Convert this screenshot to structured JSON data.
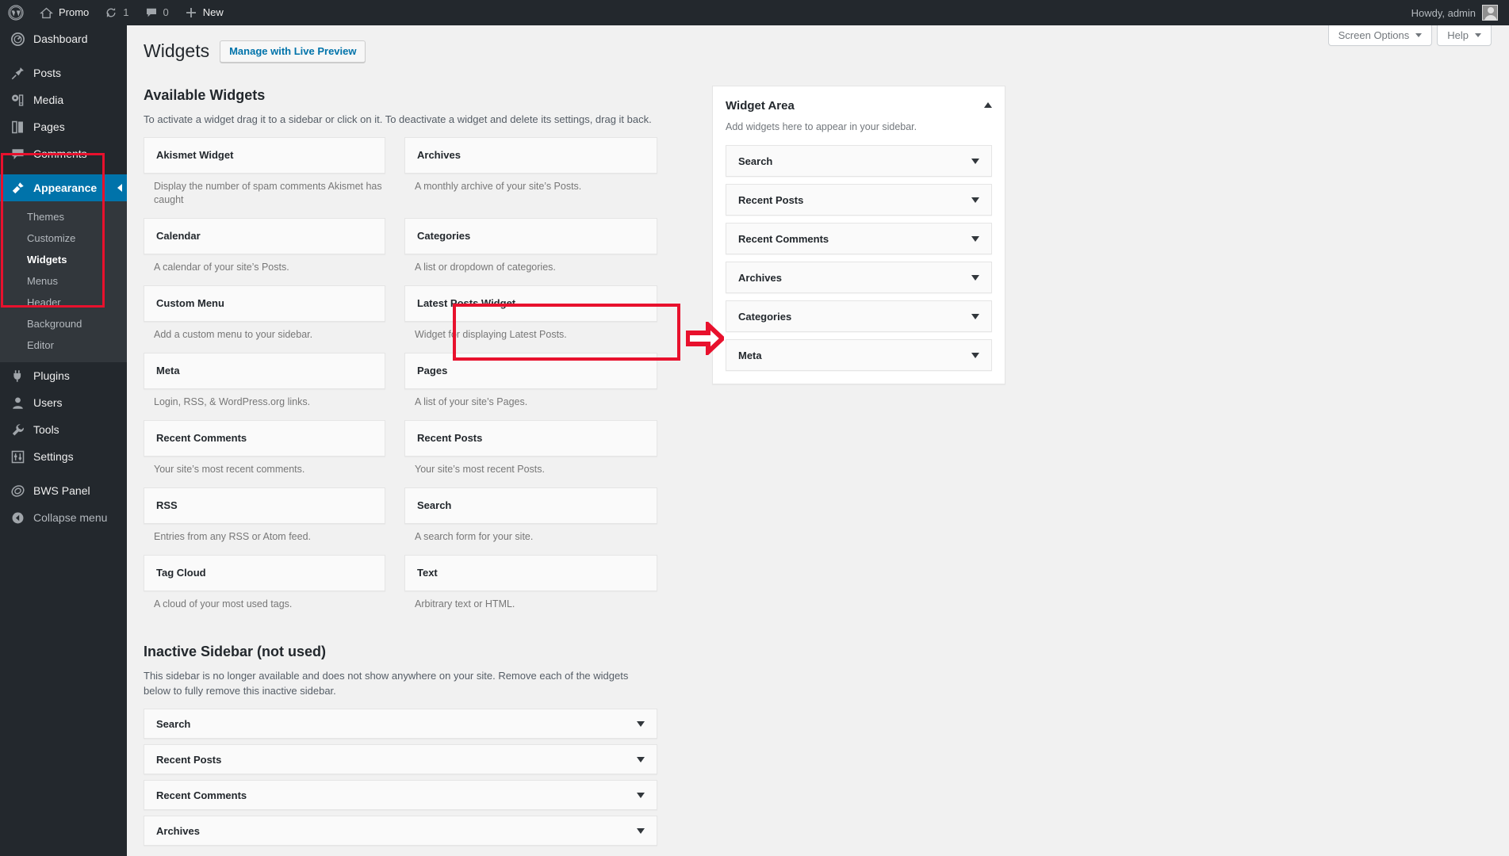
{
  "adminbar": {
    "wp_logo_label": "wordpress-logo",
    "site_name": "Promo",
    "updates_count": "1",
    "comments_count": "0",
    "new_label": "New",
    "howdy": "Howdy, admin"
  },
  "sidebar": {
    "items": [
      {
        "label": "Dashboard",
        "icon": "dashboard-icon"
      },
      {
        "label": "Posts",
        "icon": "posts-pin-icon"
      },
      {
        "label": "Media",
        "icon": "media-icon"
      },
      {
        "label": "Pages",
        "icon": "pages-icon"
      },
      {
        "label": "Comments",
        "icon": "comments-icon"
      },
      {
        "label": "Appearance",
        "icon": "appearance-brush-icon"
      },
      {
        "label": "Plugins",
        "icon": "plugins-plug-icon"
      },
      {
        "label": "Users",
        "icon": "users-icon"
      },
      {
        "label": "Tools",
        "icon": "tools-wrench-icon"
      },
      {
        "label": "Settings",
        "icon": "settings-sliders-icon"
      },
      {
        "label": "BWS Panel",
        "icon": "bws-panel-icon"
      },
      {
        "label": "Collapse menu",
        "icon": "collapse-arrow-icon"
      }
    ],
    "appearance_submenu": [
      {
        "label": "Themes"
      },
      {
        "label": "Customize"
      },
      {
        "label": "Widgets"
      },
      {
        "label": "Menus"
      },
      {
        "label": "Header"
      },
      {
        "label": "Background"
      },
      {
        "label": "Editor"
      }
    ]
  },
  "screen_meta": {
    "screen_options": "Screen Options",
    "help": "Help"
  },
  "header": {
    "page_title": "Widgets",
    "live_preview_button": "Manage with Live Preview"
  },
  "available": {
    "heading": "Available Widgets",
    "description": "To activate a widget drag it to a sidebar or click on it. To deactivate a widget and delete its settings, drag it back.",
    "widgets": [
      {
        "name": "Akismet Widget",
        "desc": "Display the number of spam comments Akismet has caught"
      },
      {
        "name": "Archives",
        "desc": "A monthly archive of your site’s Posts."
      },
      {
        "name": "Calendar",
        "desc": "A calendar of your site’s Posts."
      },
      {
        "name": "Categories",
        "desc": "A list or dropdown of categories."
      },
      {
        "name": "Custom Menu",
        "desc": "Add a custom menu to your sidebar."
      },
      {
        "name": "Latest Posts Widget",
        "desc": "Widget for displaying Latest Posts."
      },
      {
        "name": "Meta",
        "desc": "Login, RSS, & WordPress.org links."
      },
      {
        "name": "Pages",
        "desc": "A list of your site’s Pages."
      },
      {
        "name": "Recent Comments",
        "desc": "Your site’s most recent comments."
      },
      {
        "name": "Recent Posts",
        "desc": "Your site’s most recent Posts."
      },
      {
        "name": "RSS",
        "desc": "Entries from any RSS or Atom feed."
      },
      {
        "name": "Search",
        "desc": "A search form for your site."
      },
      {
        "name": "Tag Cloud",
        "desc": "A cloud of your most used tags."
      },
      {
        "name": "Text",
        "desc": "Arbitrary text or HTML."
      }
    ]
  },
  "inactive_sidebar": {
    "heading": "Inactive Sidebar (not used)",
    "description": "This sidebar is no longer available and does not show anywhere on your site. Remove each of the widgets below to fully remove this inactive sidebar.",
    "widgets": [
      {
        "name": "Search"
      },
      {
        "name": "Recent Posts"
      },
      {
        "name": "Recent Comments"
      },
      {
        "name": "Archives"
      }
    ]
  },
  "widget_area": {
    "title": "Widget Area",
    "description": "Add widgets here to appear in your sidebar.",
    "widgets": [
      {
        "name": "Search"
      },
      {
        "name": "Recent Posts"
      },
      {
        "name": "Recent Comments"
      },
      {
        "name": "Archives"
      },
      {
        "name": "Categories"
      },
      {
        "name": "Meta"
      }
    ]
  },
  "annotations": {
    "highlight_color": "#e8112d",
    "appearance_highlight": "appearance-menu-highlight",
    "latest_posts_highlight": "latest-posts-widget-highlight",
    "arrow": "drag-direction-arrow"
  },
  "colors": {
    "admin_dark": "#23282d",
    "admin_submenu": "#32373c",
    "accent_blue": "#0073aa",
    "page_bg": "#f1f1f1"
  }
}
